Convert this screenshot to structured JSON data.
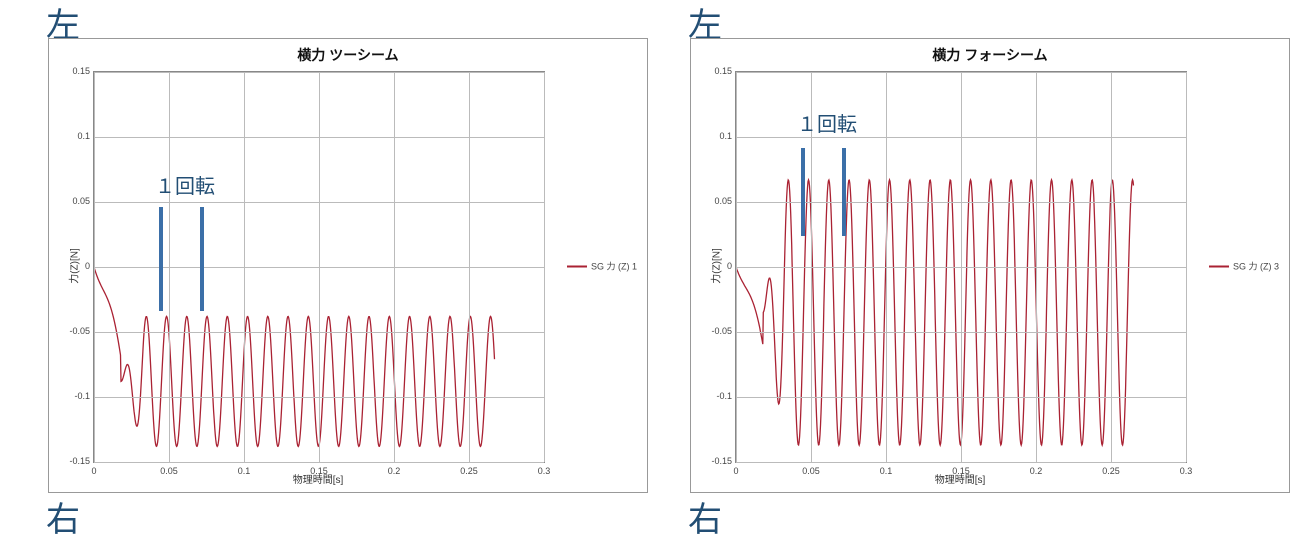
{
  "labels": {
    "left_top": "左",
    "left_bottom": "右",
    "right_top": "左",
    "right_bottom": "右",
    "rotation": "１回転"
  },
  "charts": [
    {
      "title": "横力 ツーシーム",
      "xlabel": "物理時間[s]",
      "ylabel": "力(Z)[N]",
      "legend": "SG 力 (Z) 1",
      "xlim": [
        0,
        0.3
      ],
      "ylim": [
        -0.15,
        0.15
      ],
      "xticks": [
        0,
        0.05,
        0.1,
        0.15,
        0.2,
        0.25,
        0.3
      ],
      "yticks": [
        -0.15,
        -0.1,
        -0.05,
        0,
        0.05,
        0.1,
        0.15
      ],
      "annotation": {
        "text_key": "rotation",
        "text_x": 0.046,
        "text_y": 0.055,
        "bar1_x": 0.046,
        "bar2_x": 0.073,
        "bar_top": 0.045,
        "bar_bottom": -0.035
      }
    },
    {
      "title": "横力 フォーシーム",
      "xlabel": "物理時間[s]",
      "ylabel": "力(Z)[N]",
      "legend": "SG 力 (Z) 3",
      "xlim": [
        0,
        0.3
      ],
      "ylim": [
        -0.15,
        0.15
      ],
      "xticks": [
        0,
        0.05,
        0.1,
        0.15,
        0.2,
        0.25,
        0.3
      ],
      "yticks": [
        -0.15,
        -0.1,
        -0.05,
        0,
        0.05,
        0.1,
        0.15
      ],
      "annotation": {
        "text_key": "rotation",
        "text_x": 0.046,
        "text_y": 0.102,
        "bar1_x": 0.046,
        "bar2_x": 0.073,
        "bar_top": 0.09,
        "bar_bottom": 0.022
      }
    }
  ],
  "chart_data": [
    {
      "type": "line",
      "title": "横力 ツーシーム",
      "xlabel": "物理時間[s]",
      "ylabel": "力(Z)[N]",
      "xlim": [
        0,
        0.3
      ],
      "ylim": [
        -0.15,
        0.15
      ],
      "series": [
        {
          "name": "SG 力 (Z) 1",
          "note": "oscillation period 0.0135 s (one rotation spans ~2 periods ≈ 0.027 s); DC offset ≈ -0.088; amplitude ≈ 0.050; initial transient 0–0.03 s starting near 0 and dipping to ≈ -0.07; ends at x≈0.267",
          "x_range": [
            0,
            0.267
          ],
          "period_s": 0.0135,
          "offset": -0.088,
          "amplitude": 0.05,
          "crest_value": -0.038,
          "trough_value": -0.138
        }
      ]
    },
    {
      "type": "line",
      "title": "横力 フォーシーム",
      "xlabel": "物理時間[s]",
      "ylabel": "力(Z)[N]",
      "xlim": [
        0,
        0.3
      ],
      "ylim": [
        -0.15,
        0.15
      ],
      "series": [
        {
          "name": "SG 力 (Z) 3",
          "note": "oscillation period 0.0135 s; DC offset ≈ -0.035; amplitude ≈ 0.102; initial transient 0–0.02 s; ends at x≈0.265",
          "x_range": [
            0,
            0.265
          ],
          "period_s": 0.0135,
          "offset": -0.035,
          "amplitude": 0.102,
          "crest_value": 0.067,
          "trough_value": -0.137
        }
      ]
    }
  ]
}
